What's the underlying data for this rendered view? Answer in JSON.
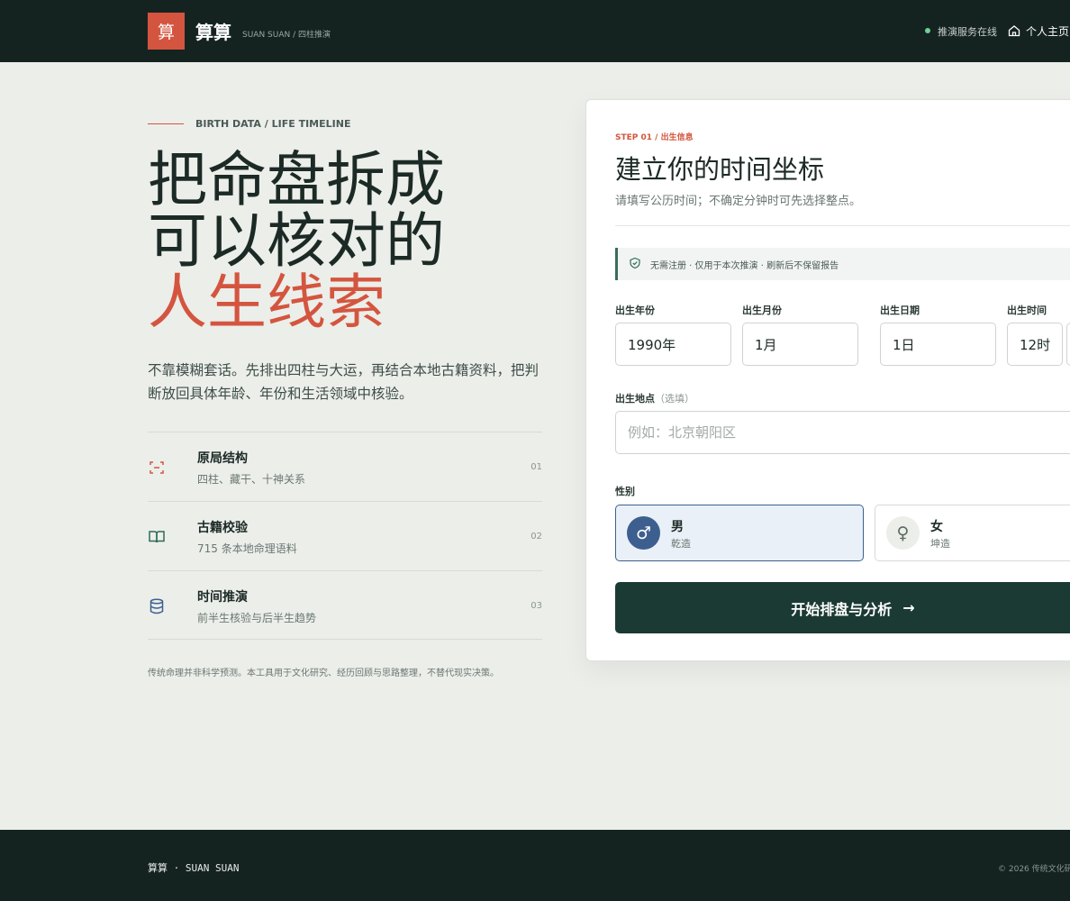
{
  "header": {
    "logo_char": "算",
    "brand": "算算",
    "brand_sub": "SUAN SUAN / 四柱推演",
    "status": "推演服务在线",
    "home_link": "个人主页"
  },
  "hero": {
    "eyebrow": "BIRTH DATA / LIFE TIMELINE",
    "headline_line1": "把命盘拆成",
    "headline_line2": "可以核对的",
    "headline_line3": "人生线索",
    "intro": "不靠模糊套话。先排出四柱与大运，再结合本地古籍资料，把判断放回具体年龄、年份和生活领域中核验。"
  },
  "features": [
    {
      "title": "原局结构",
      "desc": "四柱、藏干、十神关系",
      "num": "01",
      "icon": "scan-icon"
    },
    {
      "title": "古籍校验",
      "desc": "715 条本地命理语料",
      "num": "02",
      "icon": "book-icon"
    },
    {
      "title": "时间推演",
      "desc": "前半生核验与后半生趋势",
      "num": "03",
      "icon": "database-icon"
    }
  ],
  "disclaimer": "传统命理并非科学预测。本工具用于文化研究、经历回顾与思路整理，不替代现实决策。",
  "form": {
    "step": "STEP 01 / 出生信息",
    "title": "建立你的时间坐标",
    "subtitle": "请填写公历时间；不确定分钟时可先选择整点。",
    "notice": "无需注册 · 仅用于本次推演 · 刷新后不保留报告",
    "year_label": "出生年份",
    "year_value": "1990年",
    "month_label": "出生月份",
    "month_value": "1月",
    "day_label": "出生日期",
    "day_value": "1日",
    "time_label": "出生时间",
    "hour_value": "12时",
    "place_label": "出生地点",
    "place_optional": "（选填）",
    "place_placeholder": "例如：北京朝阳区",
    "gender_label": "性别",
    "male_label": "男",
    "male_sub": "乾造",
    "female_label": "女",
    "female_sub": "坤造",
    "submit_label": "开始排盘与分析",
    "submit_arrow": "→"
  },
  "footer": {
    "brand": "算算 · SUAN SUAN",
    "copyright": "© 2026 传统文化研"
  },
  "colors": {
    "accent": "#d4553f",
    "dark": "#152320",
    "button": "#1b3a34",
    "male": "#3d5f8f",
    "status": "#6fcf97"
  }
}
